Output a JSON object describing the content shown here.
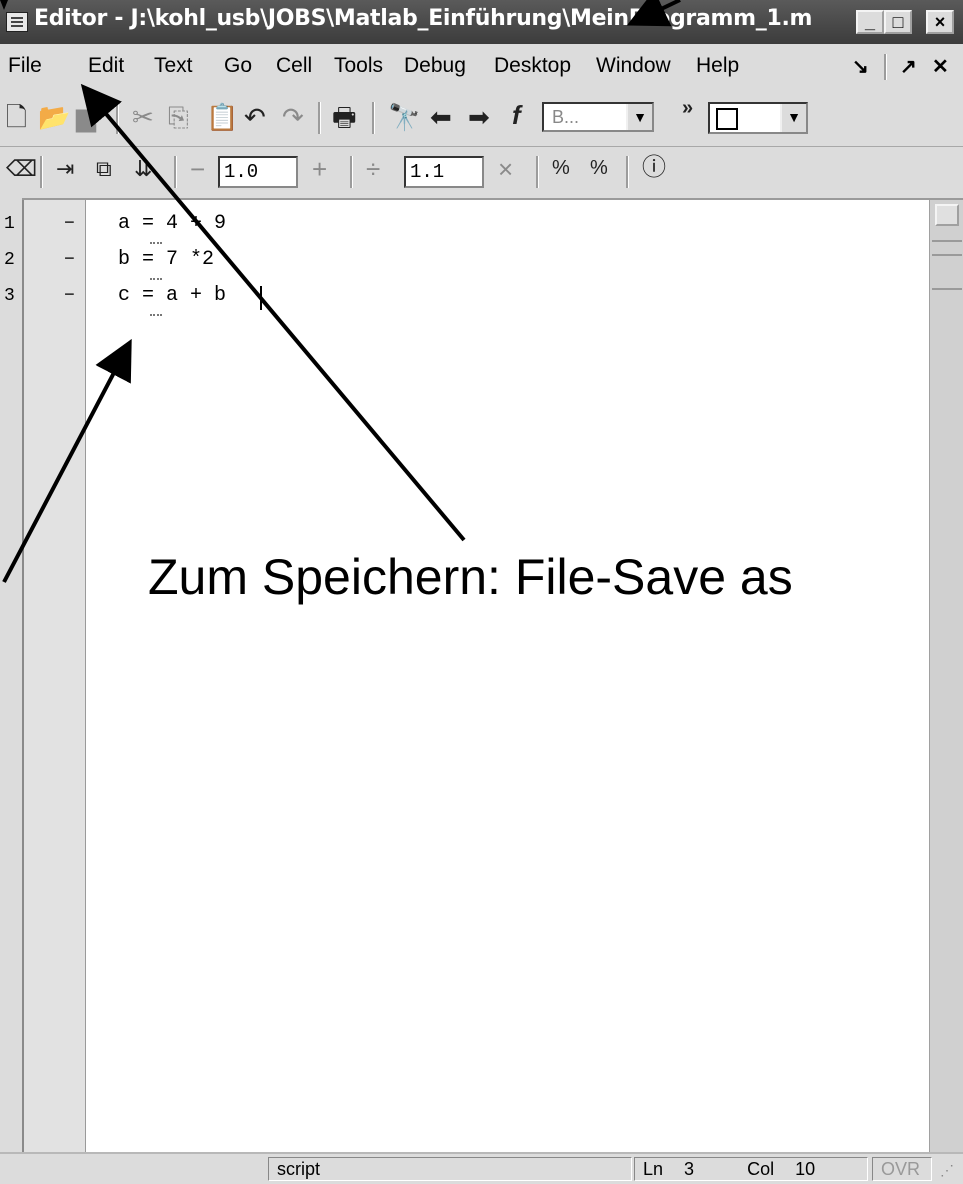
{
  "window": {
    "title": "Editor - J:\\kohl_usb\\JOBS\\Matlab_Einführung\\MeinProgramm_1.m",
    "buttons": [
      "_",
      "□",
      "×"
    ]
  },
  "menubar": {
    "items": [
      "File",
      "Edit",
      "Text",
      "Go",
      "Cell",
      "Tools",
      "Debug",
      "Desktop",
      "Window",
      "Help"
    ],
    "right_icons": [
      "↘",
      "↗",
      "✕"
    ]
  },
  "toolbar1": {
    "icons": [
      "new-file-icon",
      "open-folder-icon",
      "save-icon",
      "cut-icon",
      "copy-icon",
      "paste-icon",
      "undo-icon",
      "redo-icon",
      "print-icon",
      "find-icon",
      "back-icon",
      "forward-icon",
      "function-icon"
    ],
    "stack_dropdown": "B...",
    "overflow": "»"
  },
  "toolbar2": {
    "decrement_value": "1.0",
    "divide_value": "1.1",
    "minus": "−",
    "plus": "+",
    "divide": "÷",
    "times": "×"
  },
  "editor": {
    "lines": [
      {
        "num": "1",
        "dash": "−",
        "code": "a = 4 + 9"
      },
      {
        "num": "2",
        "dash": "−",
        "code": "b = 7 *2"
      },
      {
        "num": "3",
        "dash": "−",
        "code": "c = a + b"
      }
    ]
  },
  "statusbar": {
    "mode": "script",
    "ln_label": "Ln",
    "ln_value": "3",
    "col_label": "Col",
    "col_value": "10",
    "ovr": "OVR"
  },
  "annotation": {
    "text": "Zum Speichern: File-Save as"
  }
}
